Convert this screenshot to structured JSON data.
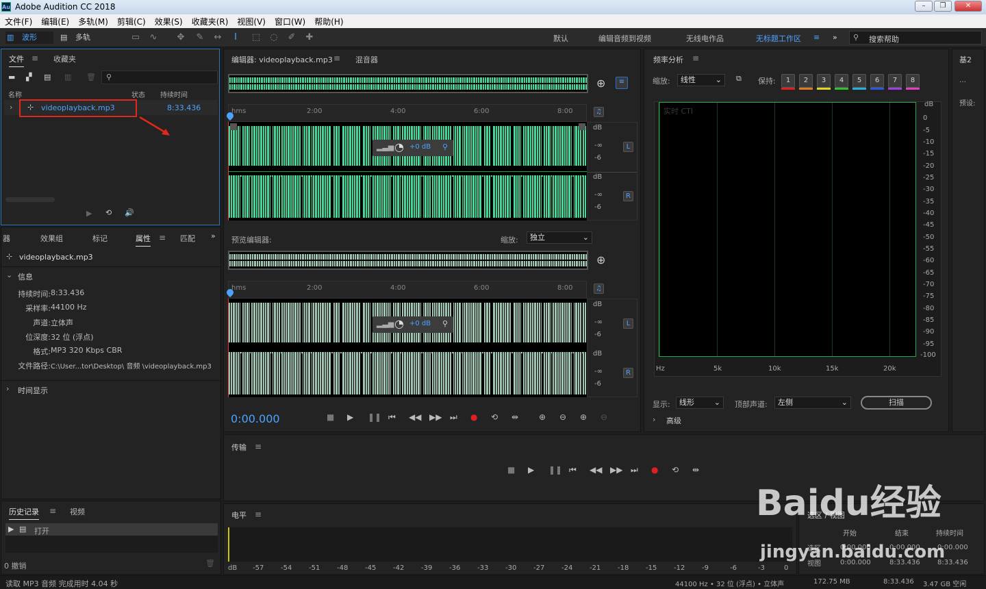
{
  "app": {
    "title": "Adobe Audition CC 2018",
    "icon": "Au"
  },
  "menu": [
    "文件(F)",
    "编辑(E)",
    "多轨(M)",
    "剪辑(C)",
    "效果(S)",
    "收藏夹(R)",
    "视图(V)",
    "窗口(W)",
    "帮助(H)"
  ],
  "toolbar": {
    "waveform": "波形",
    "multitrack": "多轨",
    "workspaces": [
      "默认",
      "编辑音频到视频",
      "无线电作品",
      "无标题工作区"
    ],
    "search": "搜索帮助"
  },
  "files_panel": {
    "tabs": [
      "文件",
      "收藏夹"
    ],
    "col_name": "名称",
    "col_status": "状态",
    "col_duration": "持续时间",
    "item_name": "videoplayback.mp3",
    "item_duration": "8:33.436"
  },
  "props_panel": {
    "tabs": [
      "器",
      "效果组",
      "标记",
      "属性",
      "匹配"
    ],
    "filename": "videoplayback.mp3",
    "info_header": "信息",
    "info": [
      {
        "k": "持续时间:",
        "v": "8:33.436"
      },
      {
        "k": "采样率:",
        "v": "44100 Hz"
      },
      {
        "k": "声道:",
        "v": "立体声"
      },
      {
        "k": "位深度:",
        "v": "32 位 (浮点)"
      },
      {
        "k": "格式:",
        "v": "MP3 320 Kbps CBR"
      },
      {
        "k": "文件路径:",
        "v": "C:\\User...tor\\Desktop\\ 音频 \\videoplayback.mp3"
      }
    ],
    "time_display": "时间显示"
  },
  "history_panel": {
    "tabs": [
      "历史记录",
      "视频"
    ],
    "item": "打开",
    "undo": "0 撤销"
  },
  "editor": {
    "tab": "编辑器: videoplayback.mp3",
    "mixer": "混音器",
    "ruler": [
      "hms",
      "2:00",
      "4:00",
      "6:00",
      "8:00"
    ],
    "db_top": [
      "dB",
      "-∞",
      "-6"
    ],
    "db_bot": [
      "dB",
      "-∞",
      "-6"
    ],
    "L": "L",
    "R": "R",
    "hud_gain": "+0 dB"
  },
  "preview": {
    "label": "预览编辑器:",
    "zoom_label": "缩放:",
    "zoom_value": "独立",
    "ruler": [
      "hms",
      "2:00",
      "4:00",
      "6:00",
      "8:00"
    ],
    "hud_gain": "+0 dB",
    "L": "L",
    "R": "R"
  },
  "transport": {
    "time": "0:00.000",
    "panel_title": "传输"
  },
  "freq": {
    "title": "频率分析",
    "zoom_label": "缩放:",
    "zoom_value": "线性",
    "hold_label": "保持:",
    "holds": [
      "1",
      "2",
      "3",
      "4",
      "5",
      "6",
      "7",
      "8"
    ],
    "hold_colors": [
      "#e02020",
      "#e07a20",
      "#e0d820",
      "#30c030",
      "#2ab0e0",
      "#2a5ae0",
      "#a040e0",
      "#e040c0"
    ],
    "cti": "实时 CTI",
    "db_scale": [
      "dB",
      "0",
      "-5",
      "-10",
      "-15",
      "-20",
      "-25",
      "-30",
      "-35",
      "-40",
      "-45",
      "-50",
      "-55",
      "-60",
      "-65",
      "-70",
      "-75",
      "-80",
      "-85",
      "-90",
      "-95",
      "-100"
    ],
    "x_labels": [
      "Hz",
      "5k",
      "10k",
      "15k",
      "20k"
    ],
    "display_label": "显示:",
    "display_value": "线形",
    "channel_label": "顶部声道:",
    "channel_value": "左侧",
    "scan": "扫描",
    "advanced": "高级"
  },
  "right_panel": {
    "title": "基2",
    "preset": "预设:"
  },
  "levels": {
    "title": "电平",
    "scale": [
      "dB",
      "-57",
      "-54",
      "-51",
      "-48",
      "-45",
      "-42",
      "-39",
      "-36",
      "-33",
      "-30",
      "-27",
      "-24",
      "-21",
      "-18",
      "-15",
      "-12",
      "-9",
      "-6",
      "-3",
      "0"
    ]
  },
  "selection": {
    "title": "选区 / 视图",
    "col_start": "开始",
    "col_end": "结束",
    "col_duration": "持续时间",
    "row1": "选区",
    "row2": "视图",
    "r1_start": "0:00.000",
    "r1_end": "0:00.000",
    "r1_dur": "0:00.000",
    "r2_start": "0:00.000",
    "r2_end": "8:33.436",
    "r2_dur": "8:33.436"
  },
  "status": {
    "left": "读取 MP3 音频 完成用时 4.04 秒",
    "items": [
      "44100 Hz • 32 位 (浮点) • 立体声",
      "172.75 MB",
      "8:33.436",
      "3.47 GB 空闲"
    ]
  },
  "watermark": "Baidu经验 jingyan.baidu.com"
}
